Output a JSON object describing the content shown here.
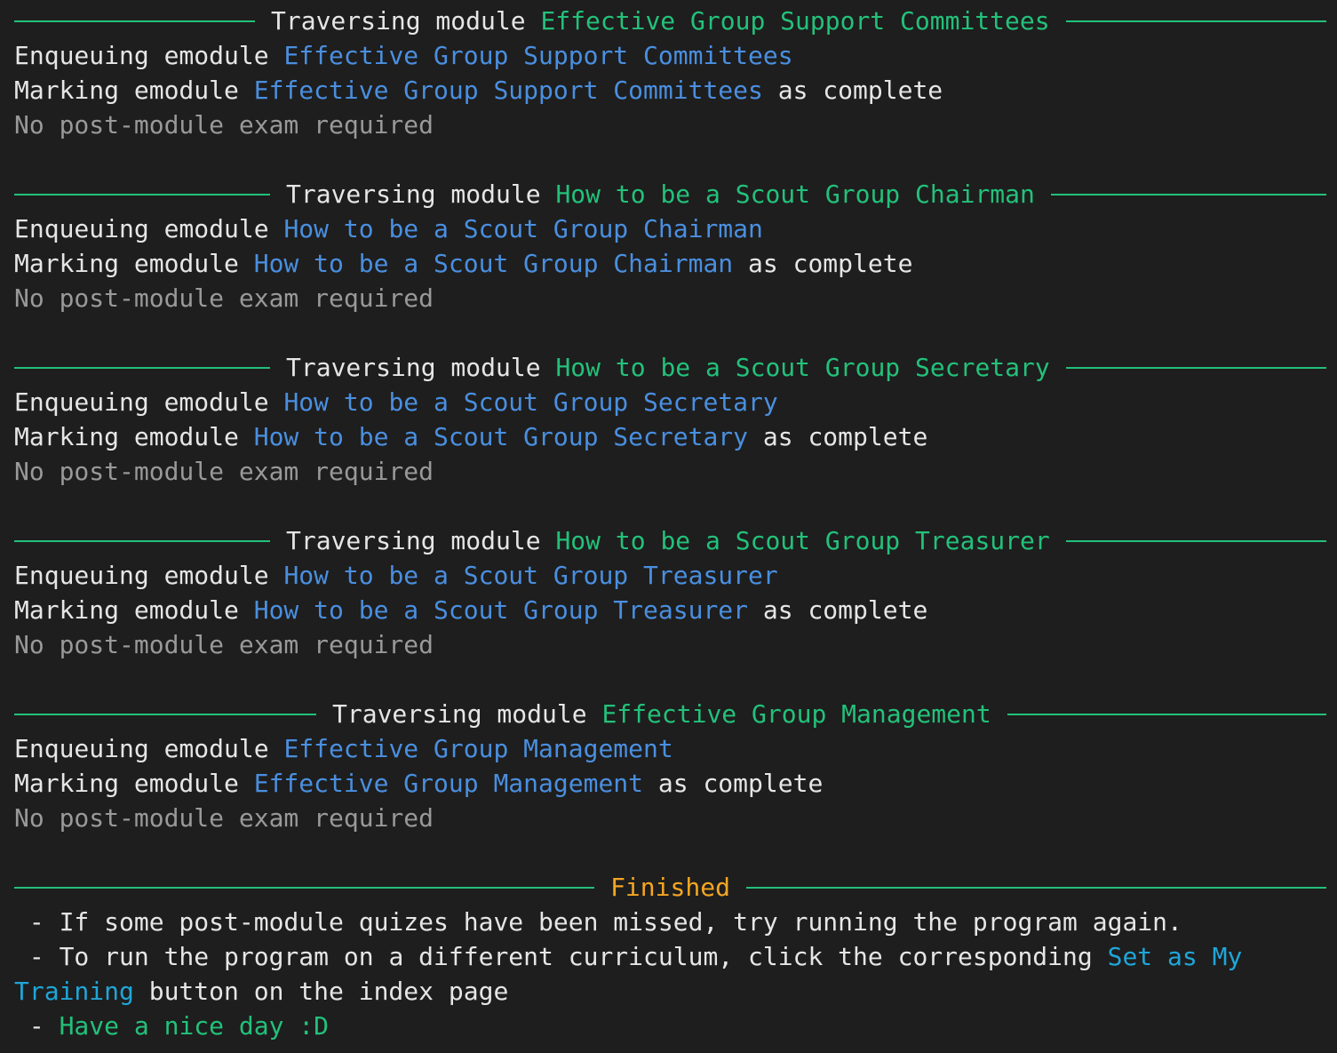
{
  "colors": {
    "background": "#1e1e1e",
    "text": "#e6e6e6",
    "rule_green": "#22c07a",
    "module_green": "#23c17a",
    "emodule_blue": "#4a8fe0",
    "muted_gray": "#999999",
    "finished_orange": "#f5a623",
    "link_cyan": "#1fa6d8"
  },
  "traversing_prefix": "Traversing module ",
  "enqueue_prefix": "Enqueuing emodule ",
  "mark_prefix": "Marking emodule ",
  "mark_suffix": " as complete",
  "no_exam_text": "No post-module exam required",
  "modules": [
    {
      "name": "Effective Group Support Committees"
    },
    {
      "name": "How to be a Scout Group Chairman"
    },
    {
      "name": "How to be a Scout Group Secretary"
    },
    {
      "name": "How to be a Scout Group Treasurer"
    },
    {
      "name": "Effective Group Management"
    }
  ],
  "finished": {
    "title": "Finished",
    "tip1": " - If some post-module quizes have been missed, try running the program again.",
    "tip2_prefix": " - To run the program on a different curriculum, click the corresponding ",
    "tip2_link": "Set as My Training",
    "tip2_suffix": " button on the index page",
    "bye_prefix": " - ",
    "bye_text": "Have a nice day :D"
  }
}
